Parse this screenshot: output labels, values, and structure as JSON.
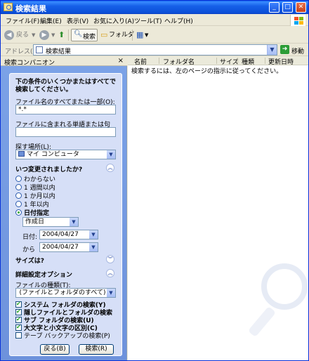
{
  "window": {
    "title": "検索結果",
    "controls": {
      "minimize": "_",
      "maximize": "□",
      "close": "✕"
    }
  },
  "menu": [
    "ファイル(F)",
    "編集(E)",
    "表示(V)",
    "お気に入り(A)",
    "ツール(T)",
    "ヘルプ(H)"
  ],
  "toolbar": {
    "back_label": "戻る",
    "search_label": "検索",
    "folders_label": "フォルダ"
  },
  "address": {
    "label": "アドレス(D)",
    "value": "検索結果",
    "go_label": "移動"
  },
  "left_pane": {
    "header": "検索コンパニオン",
    "close_glyph": "×",
    "title": "下の条件のいくつかまたはすべてで検索してください。",
    "filename_label": "ファイル名のすべてまたは一部(O):",
    "filename_value": "*.*",
    "word_label": "ファイルに含まれる単語または句(W):",
    "word_value": "",
    "lookin_label": "探す場所(L):",
    "lookin_value": "マイ コンピュータ",
    "when_heading": "いつ変更されましたか?",
    "when_options": [
      "わからない",
      "1 週間以内",
      "1 か月以内",
      "1 年以内",
      "日付指定"
    ],
    "when_selected": "日付指定",
    "date_type_value": "作成日",
    "from_label": "日付:",
    "from_value": "2004/04/27",
    "to_label": "から",
    "to_value": "2004/04/27",
    "size_heading": "サイズは?",
    "advanced_heading": "詳細設定オプション",
    "filetype_label": "ファイルの種類(T):",
    "filetype_value": "(ファイルとフォルダのすべて)",
    "checkboxes": [
      {
        "label": "システム フォルダの検索(Y)",
        "checked": true
      },
      {
        "label": "隠しファイルとフォルダの検索",
        "checked": true
      },
      {
        "label": "サブ フォルダの検索(U)",
        "checked": true
      },
      {
        "label": "大文字と小文字の区別(C)",
        "checked": true
      },
      {
        "label": "テープ バックアップの検索(P)",
        "checked": false
      }
    ],
    "back_button": "戻る(B)",
    "search_button": "検索(R)"
  },
  "right_pane": {
    "columns": [
      "名前",
      "フォルダ名",
      "サイズ",
      "種類",
      "更新日時"
    ],
    "message": "検索するには、左のページの指示に従ってください。"
  }
}
